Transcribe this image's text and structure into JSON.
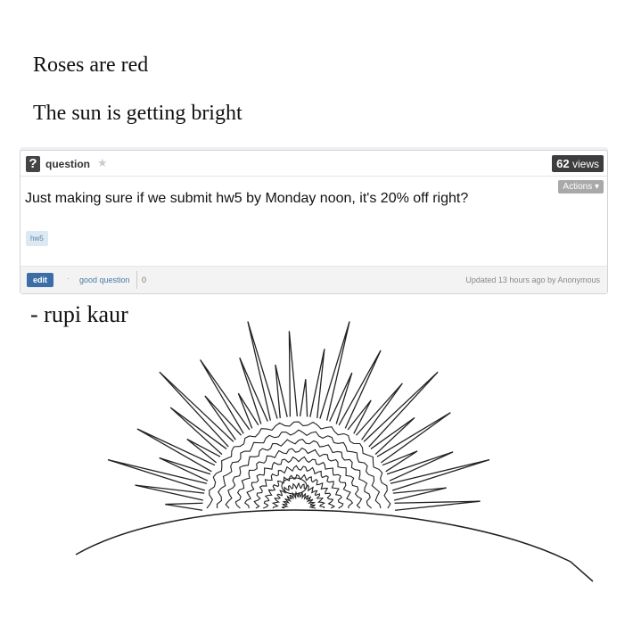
{
  "poem": {
    "line1": "Roses are red",
    "line2": "The sun is getting bright",
    "author": "- rupi kaur"
  },
  "question_card": {
    "type_icon": "question-mark-icon",
    "type_icon_text": "?",
    "type_label": "question",
    "views_count": "62",
    "views_label": "views",
    "actions_label": "Actions ▾",
    "question_text": "Just making sure if we submit hw5 by Monday noon, it's 20% off right?",
    "tags": [
      "hw5"
    ],
    "edit_label": "edit",
    "good_question_label": "good question",
    "good_question_count": "0",
    "updated_text": "Updated 13 hours ago by Anonymous"
  },
  "colors": {
    "edit_button": "#3b6ea7",
    "views_badge": "#3d3d3d",
    "tag_bg": "#dce9f3"
  }
}
